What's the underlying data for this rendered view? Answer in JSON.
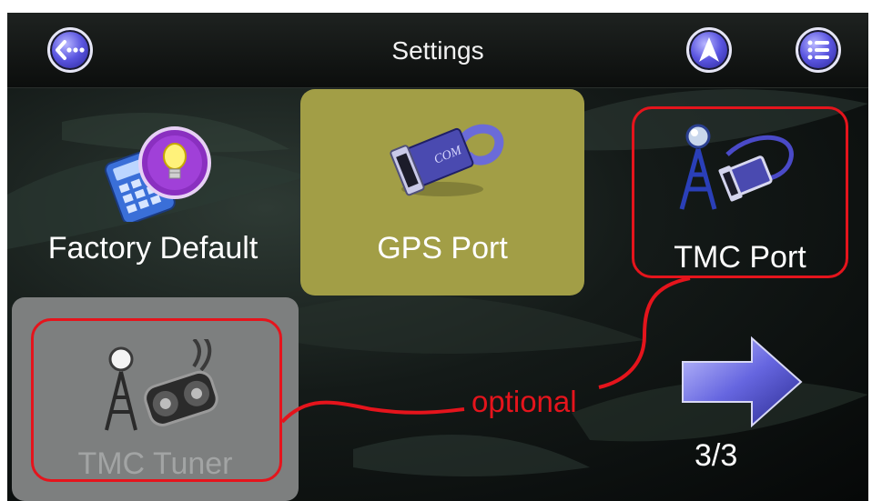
{
  "header": {
    "title": "Settings",
    "back_icon": "back-dots-icon",
    "navigation_icon": "navigation-arrow-icon",
    "menu_icon": "menu-list-icon"
  },
  "tiles": [
    {
      "label": "Factory Default",
      "icon": "lightbulb-calculator-icon",
      "state": "normal"
    },
    {
      "label": "GPS Port",
      "icon": "com-port-plug-icon",
      "state": "selected"
    },
    {
      "label": "TMC Port",
      "icon": "antenna-port-icon",
      "state": "normal"
    },
    {
      "label": "TMC Tuner",
      "icon": "antenna-tuner-icon",
      "state": "disabled"
    }
  ],
  "annotation": {
    "text": "optional",
    "color": "#e5141c"
  },
  "pagination": {
    "label": "3/3",
    "next_icon": "next-page-arrow-icon"
  },
  "colors": {
    "selected_tile": "#a29e46",
    "disabled_tile": "#7d7f7f",
    "header_button": "#5a55e0",
    "highlight": "#e5141c"
  }
}
